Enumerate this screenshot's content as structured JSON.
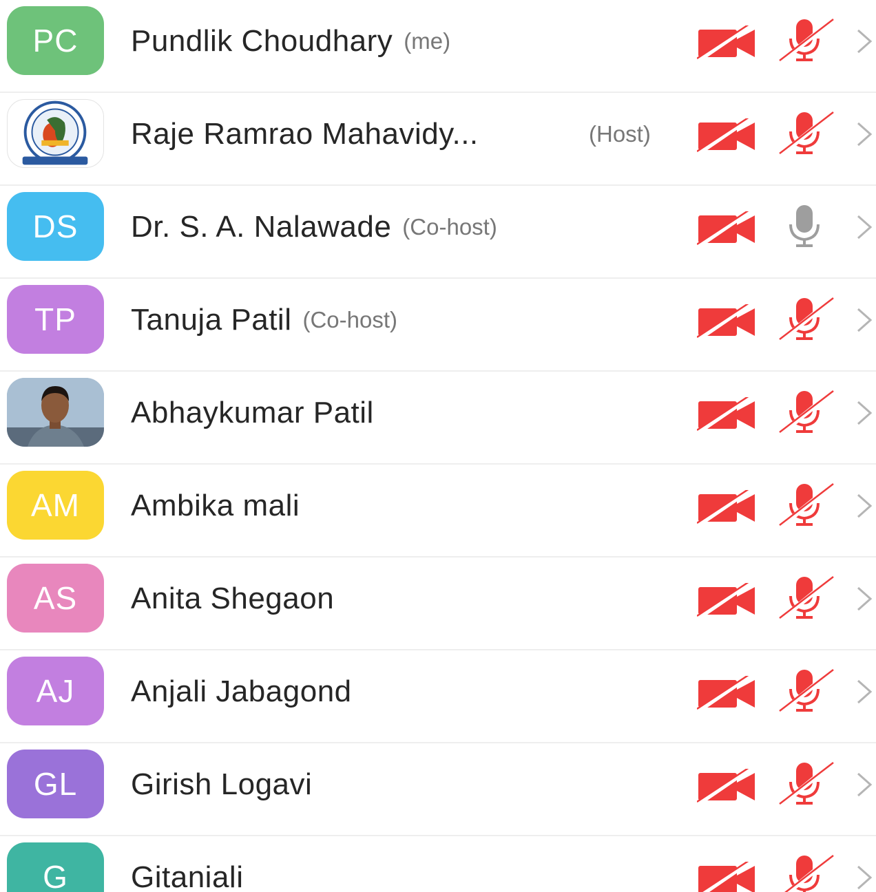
{
  "participants": [
    {
      "initials": "PC",
      "name": "Pundlik Choudhary",
      "role": "(me)",
      "avatar_type": "initials",
      "avatar_color": "#6ec27a",
      "video": "off",
      "audio": "muted"
    },
    {
      "initials": "",
      "name": "Raje Ramrao Mahavidy...",
      "role": "(Host)",
      "avatar_type": "logo",
      "avatar_color": "#ffffff",
      "video": "off",
      "audio": "muted"
    },
    {
      "initials": "DS",
      "name": "Dr. S. A. Nalawade",
      "role": "(Co-host)",
      "avatar_type": "initials",
      "avatar_color": "#45bdf0",
      "video": "off",
      "audio": "unmuted-idle"
    },
    {
      "initials": "TP",
      "name": "Tanuja Patil",
      "role": "(Co-host)",
      "avatar_type": "initials",
      "avatar_color": "#c27fe0",
      "video": "off",
      "audio": "muted"
    },
    {
      "initials": "",
      "name": "Abhaykumar Patil",
      "role": "",
      "avatar_type": "photo",
      "avatar_color": "#9fb4c9",
      "video": "off",
      "audio": "muted"
    },
    {
      "initials": "AM",
      "name": "Ambika mali",
      "role": "",
      "avatar_type": "initials",
      "avatar_color": "#fbd732",
      "video": "off",
      "audio": "muted"
    },
    {
      "initials": "AS",
      "name": "Anita Shegaon",
      "role": "",
      "avatar_type": "initials",
      "avatar_color": "#e887bd",
      "video": "off",
      "audio": "muted"
    },
    {
      "initials": "AJ",
      "name": "Anjali Jabagond",
      "role": "",
      "avatar_type": "initials",
      "avatar_color": "#c27fe0",
      "video": "off",
      "audio": "muted"
    },
    {
      "initials": "GL",
      "name": "Girish Logavi",
      "role": "",
      "avatar_type": "initials",
      "avatar_color": "#9a72d9",
      "video": "off",
      "audio": "muted"
    },
    {
      "initials": "G",
      "name": "Gitaniali",
      "role": "",
      "avatar_type": "initials",
      "avatar_color": "#3fb5a2",
      "video": "off",
      "audio": "muted"
    }
  ],
  "colors": {
    "muted_red": "#ef3b3b",
    "idle_gray": "#9e9e9e",
    "chevron_gray": "#b5b5b5",
    "name_text": "#262626",
    "role_text": "#777777"
  },
  "icons": {
    "camera": "video-off-icon",
    "mic_muted": "mic-muted-icon",
    "mic_idle": "mic-icon",
    "chevron": "chevron-right-icon",
    "logo": "college-logo-icon",
    "photo": "profile-photo"
  }
}
